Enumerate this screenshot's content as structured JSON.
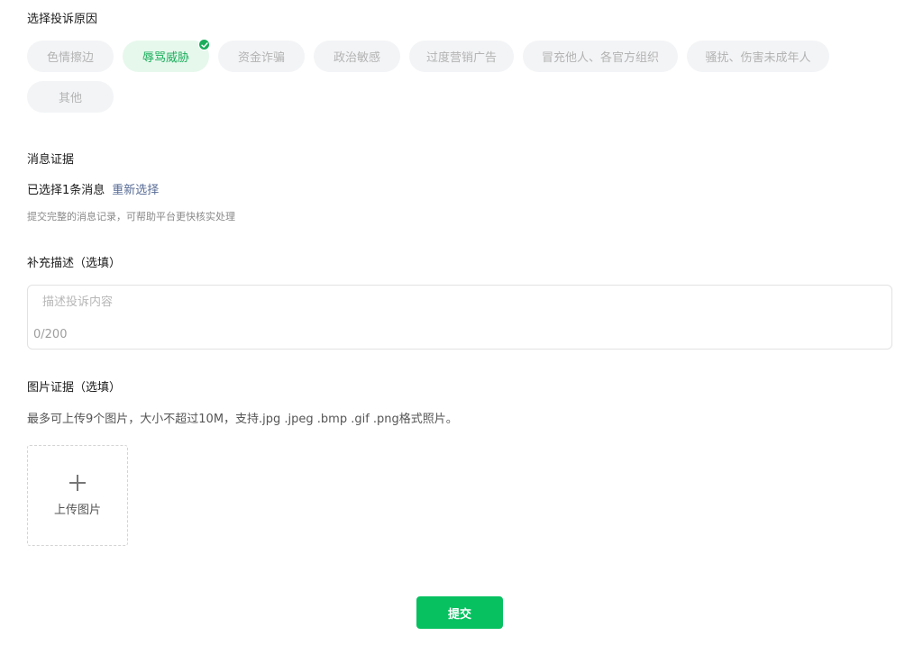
{
  "reason_section": {
    "title": "选择投诉原因",
    "options": [
      {
        "label": "色情擦边",
        "selected": false
      },
      {
        "label": "辱骂威胁",
        "selected": true
      },
      {
        "label": "资金诈骗",
        "selected": false
      },
      {
        "label": "政治敏感",
        "selected": false
      },
      {
        "label": "过度营销广告",
        "selected": false
      },
      {
        "label": "冒充他人、各官方组织",
        "selected": false
      },
      {
        "label": "骚扰、伤害未成年人",
        "selected": false
      },
      {
        "label": "其他",
        "selected": false
      }
    ]
  },
  "evidence_section": {
    "title": "消息证据",
    "selected_text": "已选择1条消息",
    "reselect_label": "重新选择",
    "hint": "提交完整的消息记录，可帮助平台更快核实处理"
  },
  "description_section": {
    "title": "补充描述（选填）",
    "placeholder": "描述投诉内容",
    "value": "",
    "counter": "0/200"
  },
  "image_section": {
    "title": "图片证据（选填）",
    "hint": "最多可上传9个图片，大小不超过10M，支持.jpg .jpeg .bmp .gif .png格式照片。",
    "upload_label": "上传图片",
    "upload_icon": "plus-icon"
  },
  "submit": {
    "label": "提交"
  },
  "colors": {
    "accent": "#07c160",
    "selected_chip_bg": "#e6f8ec",
    "selected_chip_text": "#1aad5b",
    "chip_bg": "#f3f4f6",
    "chip_text": "#b3b3b3",
    "link": "#576b95"
  }
}
